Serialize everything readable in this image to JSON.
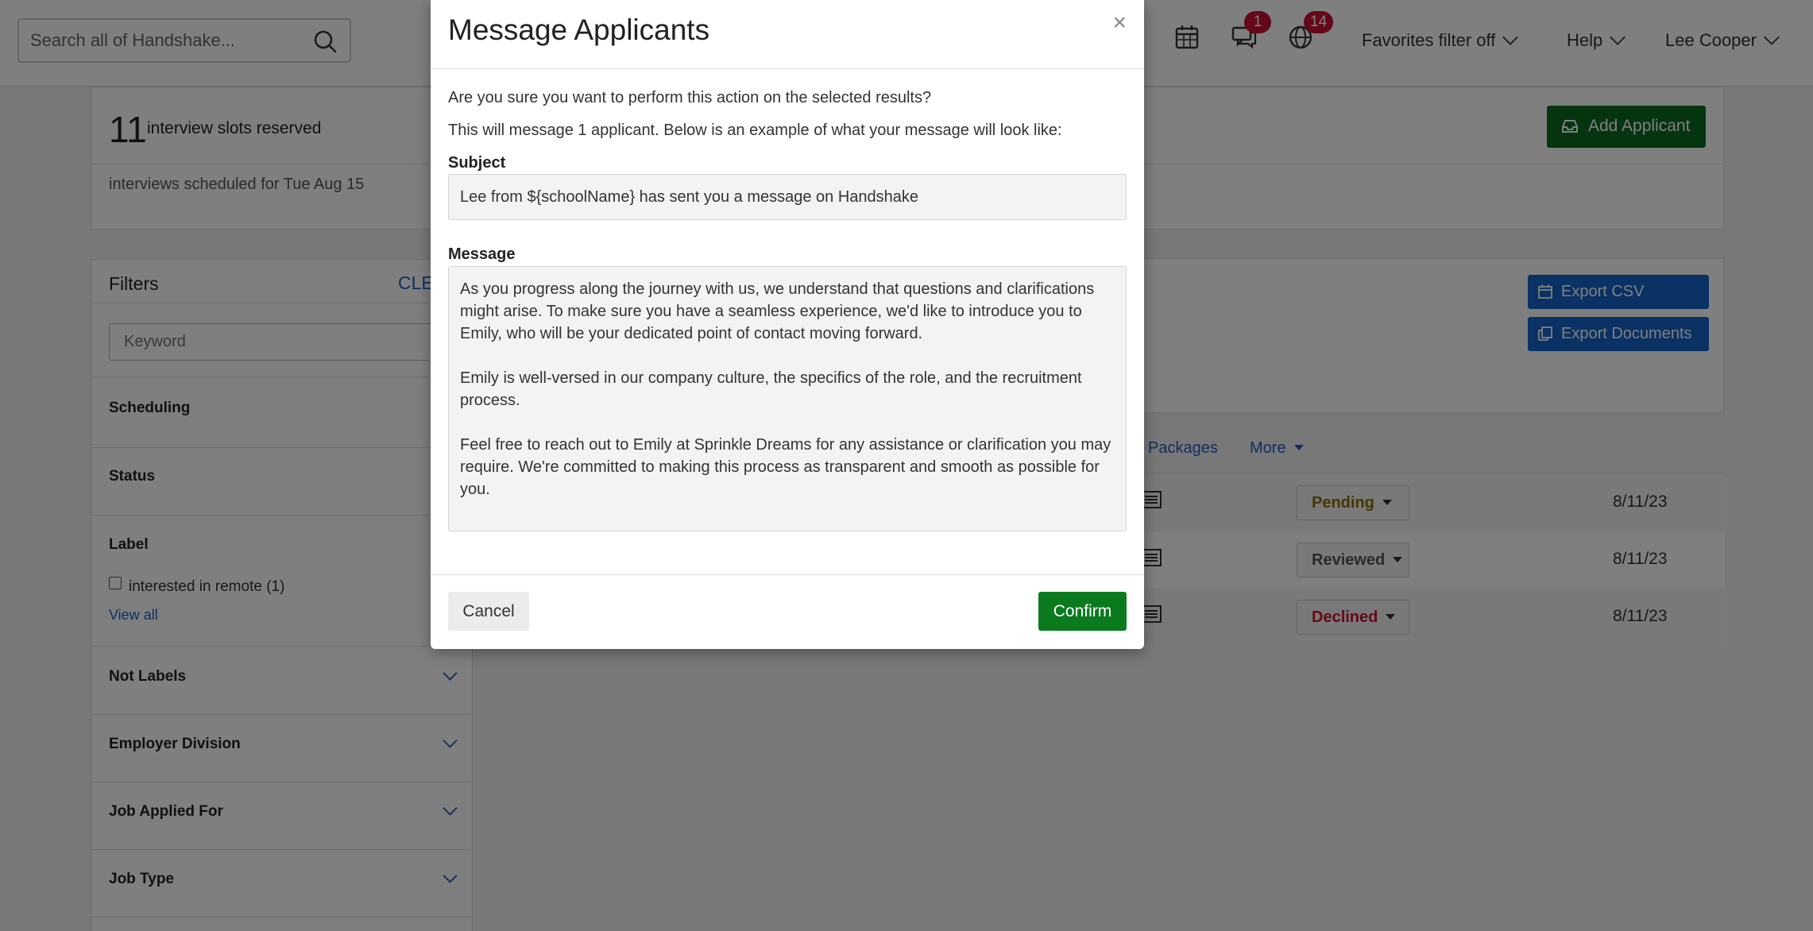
{
  "topbar": {
    "search_placeholder": "Search all of Handshake...",
    "messages_badge": "1",
    "notifications_badge": "14",
    "favorites_filter": "Favorites filter off",
    "help": "Help",
    "user_name": "Lee Cooper"
  },
  "summary": {
    "slots_count": "11",
    "slots_label": "interview slots reserved",
    "scheduled_text": "interviews scheduled for Tue Aug 15",
    "add_applicant": "Add Applicant"
  },
  "filters": {
    "title": "Filters",
    "clear": "CLE",
    "keyword_placeholder": "Keyword",
    "sections": [
      "Scheduling",
      "Status",
      "Label",
      "Not Labels",
      "Employer Division",
      "Job Applied For",
      "Job Type"
    ],
    "label_option": "interested in remote (1)",
    "view_all": "View all"
  },
  "export": {
    "csv": "Export CSV",
    "documents": "Export Documents"
  },
  "tabs": {
    "packages": "Packages",
    "more": "More"
  },
  "rows": [
    {
      "status": "Pending",
      "date": "8/11/23"
    },
    {
      "status": "Reviewed",
      "date": "8/11/23"
    },
    {
      "status": "Declined",
      "date": "8/11/23"
    }
  ],
  "colors": {
    "pending": "#8a6d00",
    "reviewed": "#555555",
    "declined": "#c8102e",
    "confirm_green": "#0b7a1f",
    "export_blue": "#1464c8"
  },
  "modal": {
    "title": "Message Applicants",
    "close": "×",
    "question": "Are you sure you want to perform this action on the selected results?",
    "info": "This will message 1 applicant. Below is an example of what your message will look like:",
    "subject_label": "Subject",
    "subject": "Lee from ${schoolName} has sent you a message on Handshake",
    "message_label": "Message",
    "message_paragraphs": [
      "As you progress along the journey with us, we understand that questions and clarifications might arise. To make sure you have a seamless experience, we'd like to introduce you to Emily, who will be your dedicated point of contact moving forward.",
      "Emily is well-versed in our company culture, the specifics of the role, and the recruitment process.",
      "Feel free to reach out to Emily at Sprinkle Dreams for any assistance or clarification you may require. We're committed to making this process as transparent and smooth as possible for you."
    ],
    "cancel": "Cancel",
    "confirm": "Confirm"
  }
}
